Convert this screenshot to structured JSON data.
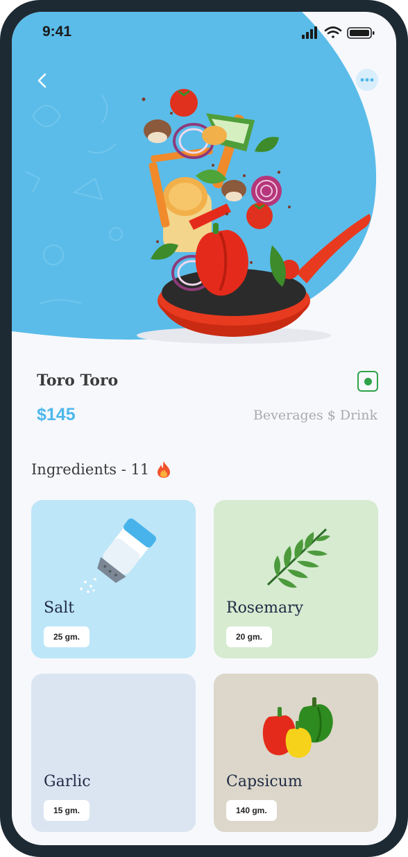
{
  "status_bar": {
    "time": "9:41"
  },
  "dish": {
    "title": "Toro Toro",
    "price": "$145",
    "category": "Beverages $ Drink",
    "veg_indicator_color": "#2fa24a"
  },
  "ingredients": {
    "heading": "Ingredients - 11",
    "items": [
      {
        "name": "Salt",
        "qty": "25 gm.",
        "bg": "#bde6f8",
        "icon": "salt-shaker-icon"
      },
      {
        "name": "Rosemary",
        "qty": "20 gm.",
        "bg": "#d6ebd0",
        "icon": "rosemary-icon"
      },
      {
        "name": "Garlic",
        "qty": "15 gm.",
        "bg": "#dbe5f2",
        "icon": ""
      },
      {
        "name": "Capsicum",
        "qty": "140 gm.",
        "bg": "#dcd7ca",
        "icon": "bell-peppers-icon"
      }
    ]
  },
  "colors": {
    "accent": "#4db8ec",
    "hero_blue": "#5bbce9",
    "pan_red": "#e83a1f"
  }
}
